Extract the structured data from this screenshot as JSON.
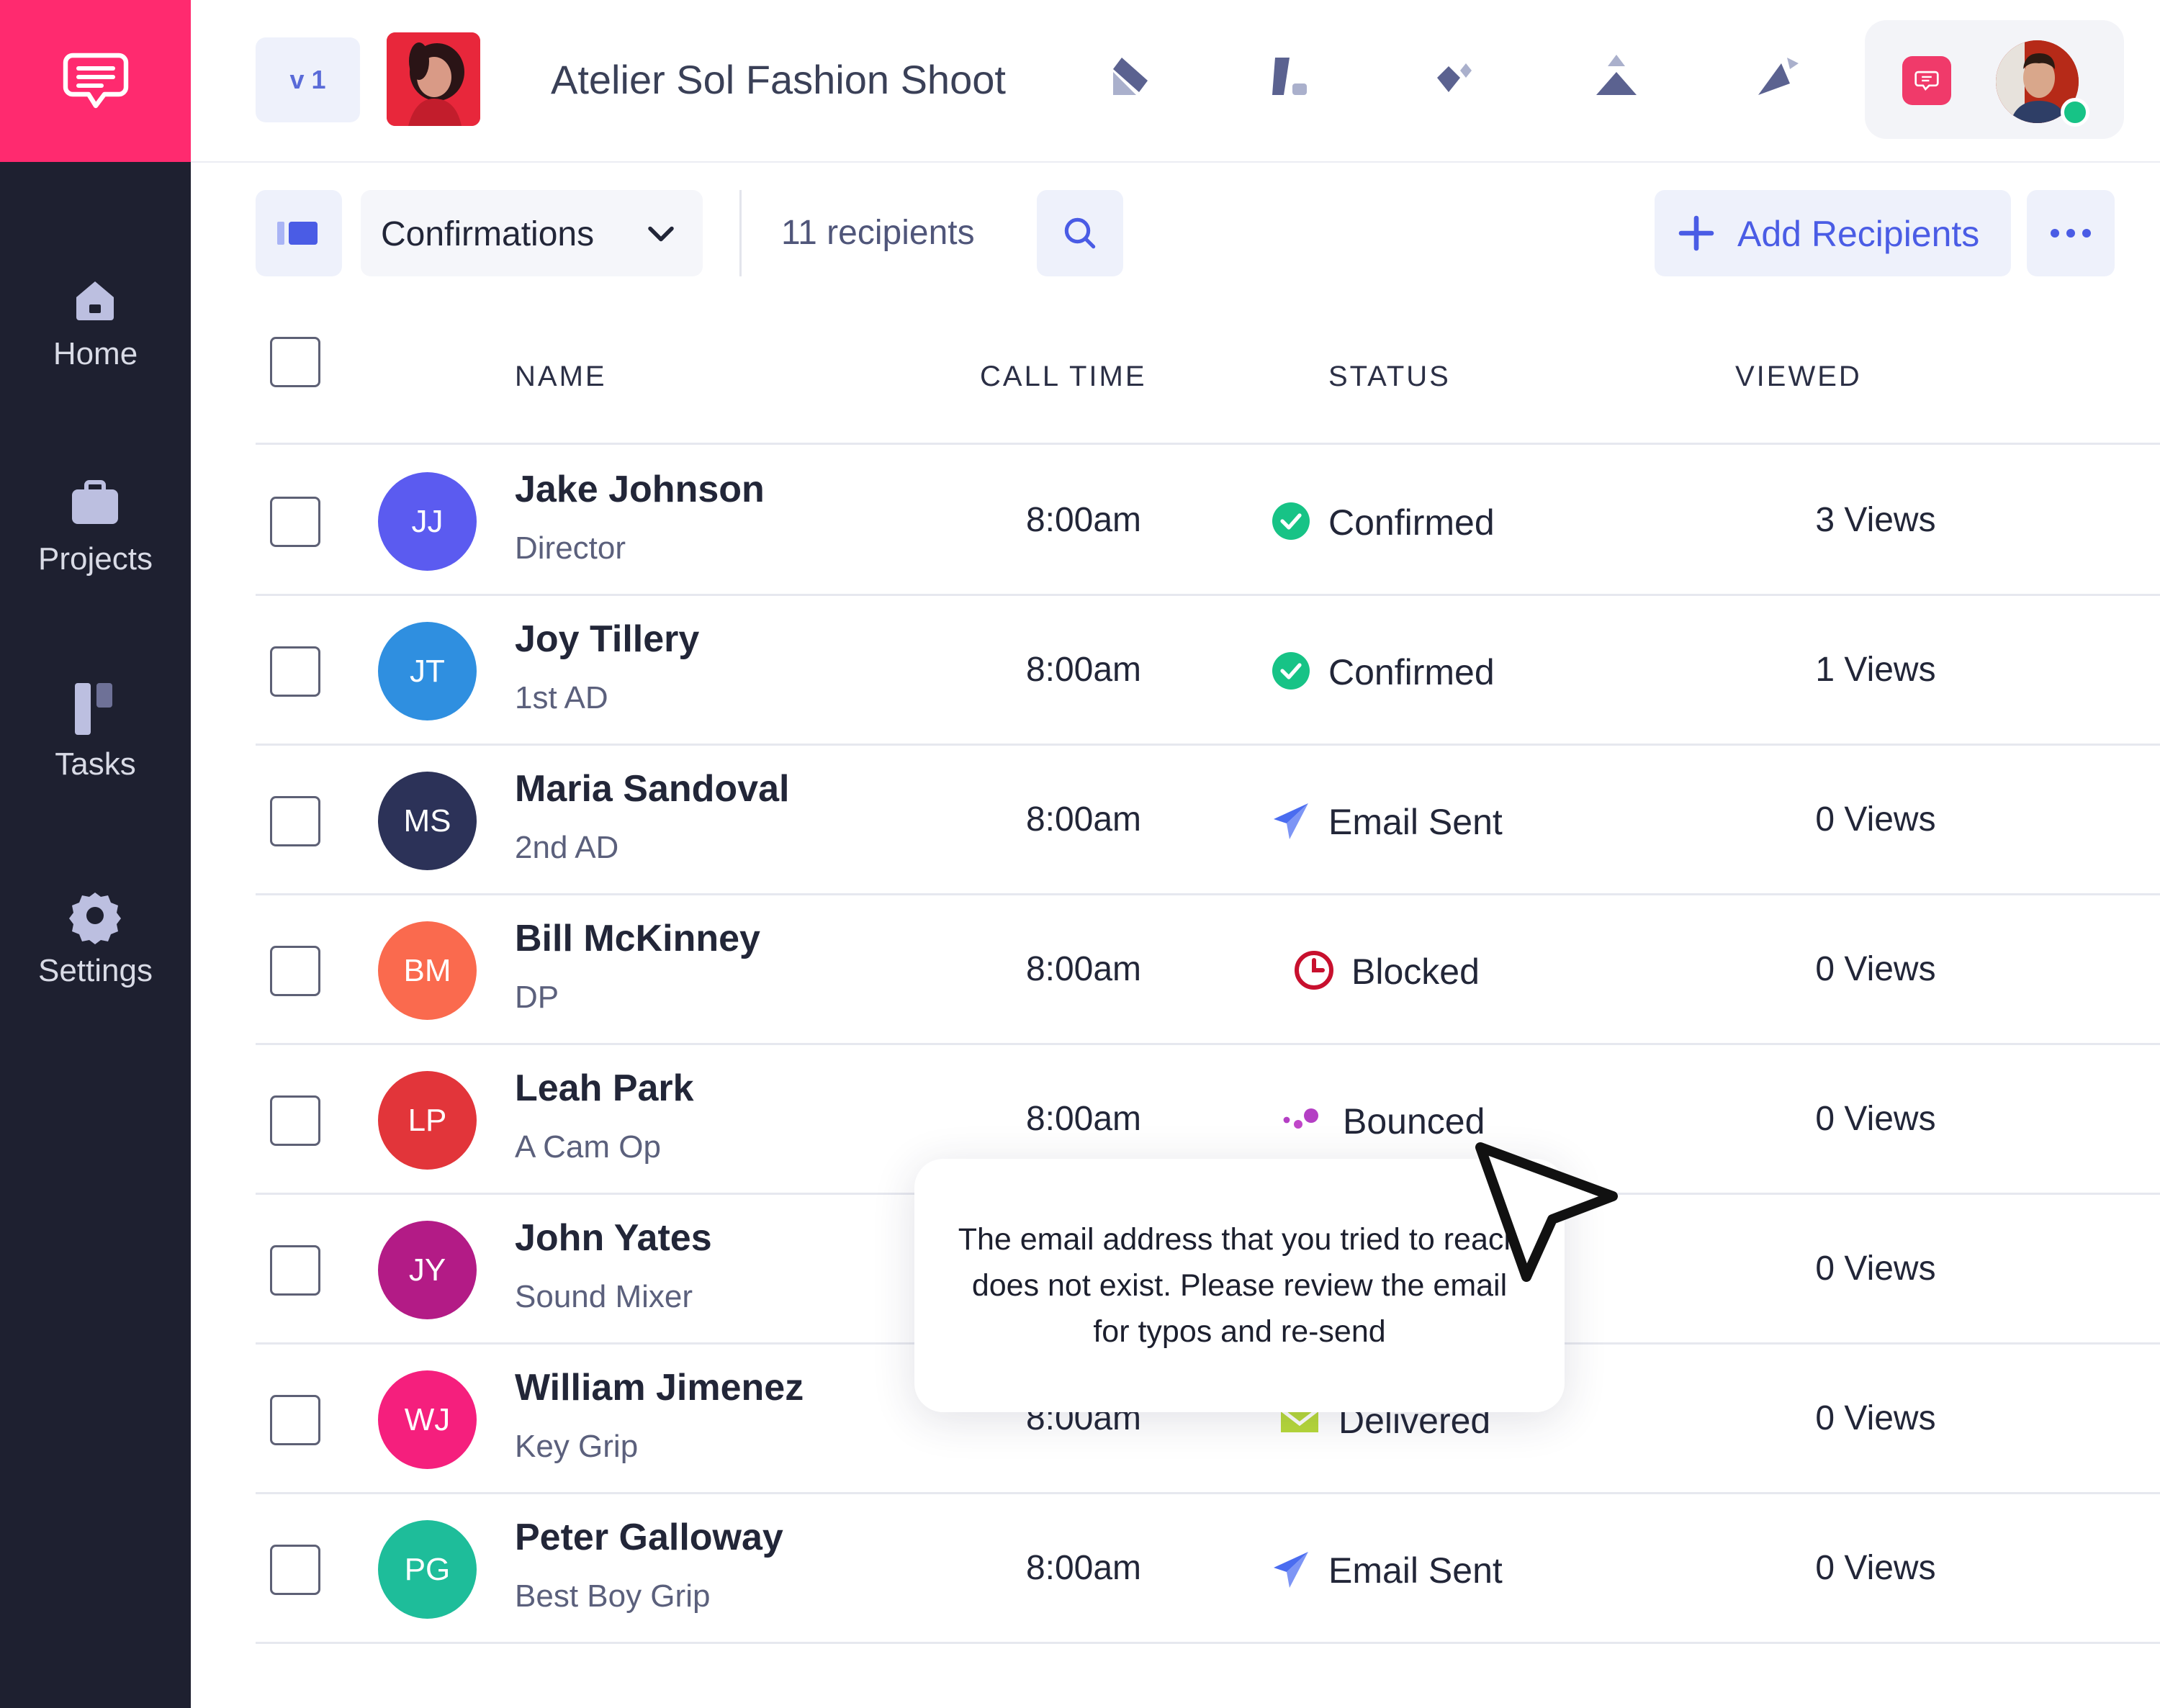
{
  "sidebar": {
    "logo_icon": "chat-bubble-icon",
    "items": [
      {
        "label": "Home",
        "icon": "home-icon"
      },
      {
        "label": "Projects",
        "icon": "briefcase-icon"
      },
      {
        "label": "Tasks",
        "icon": "board-icon"
      },
      {
        "label": "Settings",
        "icon": "gear-icon"
      }
    ]
  },
  "header": {
    "version": "v 1",
    "project_title": "Atelier Sol Fashion Shoot",
    "tools": [
      "pencil-icon",
      "shapes-icon",
      "diamond-icon",
      "arrow-up-icon",
      "send-icon"
    ]
  },
  "toolbar": {
    "list_name": "Confirmations",
    "recipients_count": "11 recipients",
    "add_label": "Add Recipients"
  },
  "table": {
    "columns": [
      "NAME",
      "CALL TIME",
      "STATUS",
      "VIEWED"
    ],
    "rows": [
      {
        "initials": "JJ",
        "name": "Jake Johnson",
        "role": "Director",
        "call_time": "8:00am",
        "status": "Confirmed",
        "views": "3 Views",
        "avatar_color": "#5b5bf0"
      },
      {
        "initials": "JT",
        "name": "Joy Tillery",
        "role": "1st AD",
        "call_time": "8:00am",
        "status": "Confirmed",
        "views": "1 Views",
        "avatar_color": "#2f8fe0"
      },
      {
        "initials": "MS",
        "name": "Maria Sandoval",
        "role": "2nd AD",
        "call_time": "8:00am",
        "status": "Email Sent",
        "views": "0 Views",
        "avatar_color": "#2c3258"
      },
      {
        "initials": "BM",
        "name": "Bill McKinney",
        "role": "DP",
        "call_time": "8:00am",
        "status": "Blocked",
        "views": "0 Views",
        "avatar_color": "#fa6a4e"
      },
      {
        "initials": "LP",
        "name": "Leah Park",
        "role": "A Cam Op",
        "call_time": "8:00am",
        "status": "Bounced",
        "views": "0 Views",
        "avatar_color": "#e2353a"
      },
      {
        "initials": "JY",
        "name": "John Yates",
        "role": "Sound Mixer",
        "call_time": "",
        "status": "",
        "views": "0 Views",
        "avatar_color": "#b31b86"
      },
      {
        "initials": "WJ",
        "name": "William Jimenez",
        "role": "Key Grip",
        "call_time": "8:00am",
        "status": "Delivered",
        "views": "0 Views",
        "avatar_color": "#f51f7d"
      },
      {
        "initials": "PG",
        "name": "Peter Galloway",
        "role": "Best Boy Grip",
        "call_time": "8:00am",
        "status": "Email Sent",
        "views": "0 Views",
        "avatar_color": "#1ebd9a"
      }
    ]
  },
  "tooltip": {
    "text": "The email address that you tried to reach does not exist. Please review the email for typos and re-send"
  },
  "colors": {
    "brand": "#ff2a6f",
    "sidebar": "#1e2030",
    "accent": "#4a5ce5",
    "confirmed": "#17c386",
    "blocked": "#c8102e",
    "bounced": "#b43fc4",
    "delivered": "#b7d93a"
  }
}
